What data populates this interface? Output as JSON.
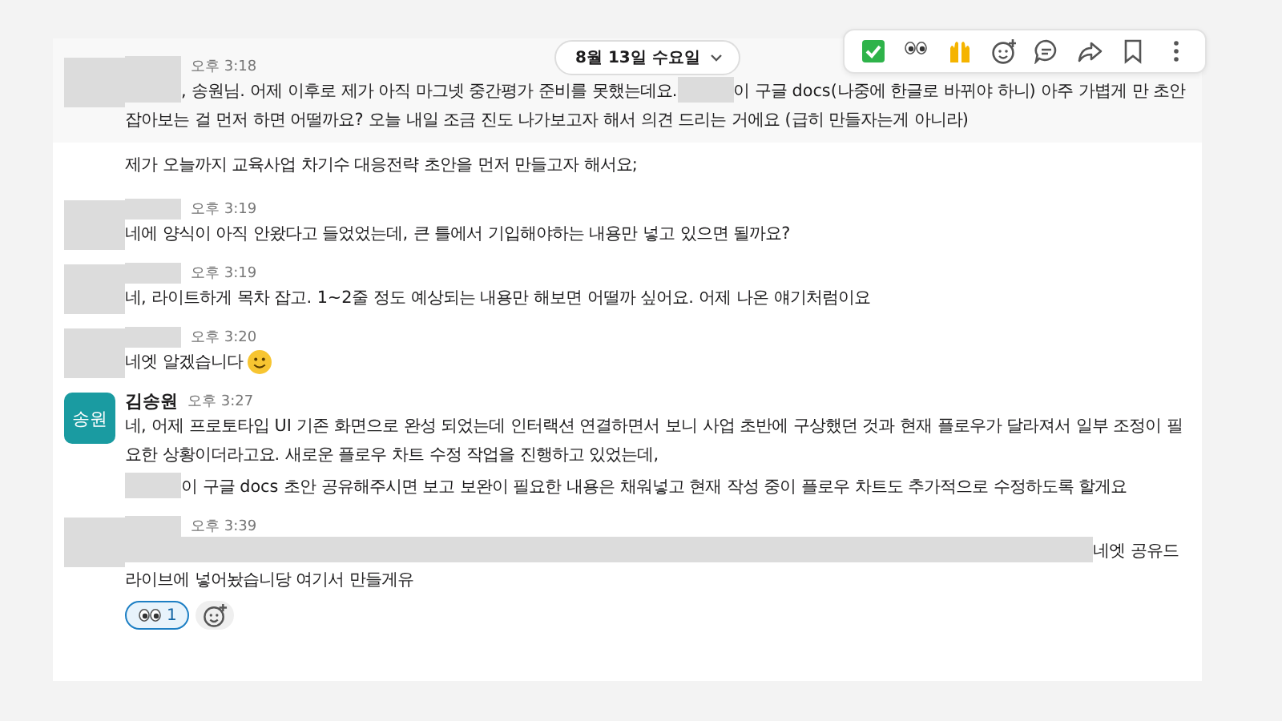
{
  "date_divider": {
    "label": "8월 13일 수요일"
  },
  "messages": [
    {
      "author": {
        "kind": "redacted"
      },
      "time": "오후 3:18",
      "hovered": true,
      "paragraphs": [
        [
          {
            "kind": "redacted"
          },
          {
            "kind": "text",
            "text": ", 송원님. 어제 이후로 제가 아직 마그넷 중간평가 준비를 못했는데요."
          },
          {
            "kind": "redacted"
          },
          {
            "kind": "text",
            "text": "이 구글 docs(나중에 한글로 바뀌야 하니) 아주 가볍게 만 초안 잡아보는 걸 먼저 하면 어떨까요? 오늘 내일 조금 진도 나가보고자 해서 의견 드리는 거에요 (급히 만들자는게 아니라)"
          }
        ]
      ]
    },
    {
      "author": {
        "kind": "continuation"
      },
      "hovered": false,
      "paragraphs": [
        [
          {
            "kind": "text",
            "text": "제가 오늘까지 교육사업 차기수 대응전략 초안을 먼저 만들고자 해서요;"
          }
        ]
      ]
    },
    {
      "author": {
        "kind": "redacted"
      },
      "time": "오후 3:19",
      "hovered": false,
      "paragraphs": [
        [
          {
            "kind": "text",
            "text": "네에 양식이 아직 안왔다고 들었었는데, 큰 틀에서 기입해야하는 내용만 넣고 있으면 될까요?"
          }
        ]
      ]
    },
    {
      "author": {
        "kind": "redacted"
      },
      "time": "오후 3:19",
      "hovered": false,
      "paragraphs": [
        [
          {
            "kind": "text",
            "text": "네, 라이트하게 목차 잡고. 1~2줄 정도 예상되는 내용만 해보면 어떨까 싶어요. 어제 나온 얘기처럼이요"
          }
        ]
      ]
    },
    {
      "author": {
        "kind": "redacted"
      },
      "time": "오후 3:20",
      "hovered": false,
      "paragraphs": [
        [
          {
            "kind": "text",
            "text": "네엣 알겠습니다 "
          },
          {
            "kind": "smiley"
          }
        ]
      ]
    },
    {
      "author": {
        "kind": "named",
        "name": "김송원",
        "initials": "송원"
      },
      "time": "오후 3:27",
      "hovered": false,
      "paragraphs": [
        [
          {
            "kind": "text",
            "text": "네, 어제 프로토타입 UI 기존 화면으로 완성 되었는데 인터랙션 연결하면서 보니 사업 초반에 구상했던 것과 현재 플로우가 달라져서 일부 조정이 필요한 상황이더라고요. 새로운 플로우 차트 수정 작업을 진행하고 있었는데,"
          }
        ],
        [
          {
            "kind": "redacted"
          },
          {
            "kind": "text",
            "text": "이 구글 docs 초안 공유해주시면 보고 보완이 필요한 내용은 채워넣고 현재 작성 중이 플로우 차트도 추가적으로 수정하도록 할게요"
          }
        ]
      ]
    },
    {
      "author": {
        "kind": "redacted"
      },
      "time": "오후 3:39",
      "hovered": false,
      "paragraphs": [
        [
          {
            "kind": "redacted_wide"
          },
          {
            "kind": "text",
            "text": "네엣 공유드라이브에 넣어놨습니당 여기서 만들게유"
          }
        ]
      ],
      "reactions": [
        {
          "count": "1",
          "selected": true
        }
      ]
    }
  ]
}
